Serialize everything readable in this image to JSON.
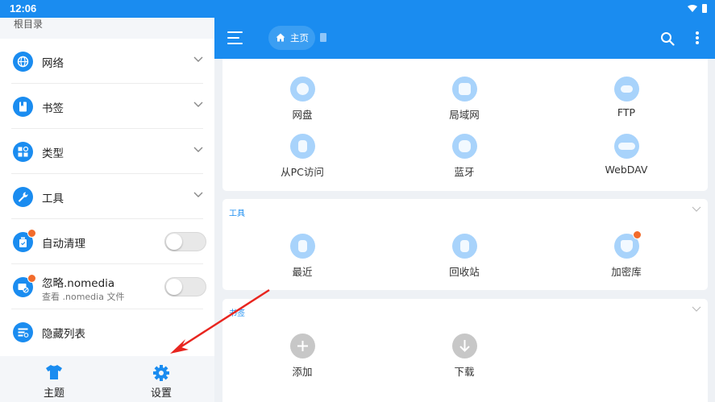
{
  "status_bar": {
    "time": "12:06"
  },
  "drawer": {
    "header_label": "根目录",
    "items": [
      {
        "label": "网络",
        "icon": "globe-icon",
        "trailing": "chevron"
      },
      {
        "label": "书签",
        "icon": "bookmark-icon",
        "trailing": "chevron"
      },
      {
        "label": "类型",
        "icon": "category-icon",
        "trailing": "chevron"
      },
      {
        "label": "工具",
        "icon": "wrench-icon",
        "trailing": "chevron"
      },
      {
        "label": "自动清理",
        "icon": "auto-clean-icon",
        "trailing": "toggle",
        "toggle_on": false,
        "premium": true
      },
      {
        "label": "忽略.nomedia",
        "sublabel": "查看 .nomedia 文件",
        "icon": "nomedia-icon",
        "trailing": "toggle",
        "toggle_on": false,
        "premium": true
      },
      {
        "label": "隐藏列表",
        "icon": "hidden-list-icon",
        "trailing": "none"
      }
    ],
    "footer": {
      "theme_label": "主题",
      "settings_label": "设置"
    }
  },
  "appbar": {
    "breadcrumb_label": "主页",
    "icons": [
      "menu-icon",
      "home-icon",
      "search-icon",
      "more-vert-icon"
    ]
  },
  "sections": {
    "network": {
      "tiles": [
        {
          "label": "网盘",
          "icon": "cloud-icon"
        },
        {
          "label": "局域网",
          "icon": "lan-icon"
        },
        {
          "label": "FTP",
          "icon": "ftp-icon"
        },
        {
          "label": "从PC访问",
          "icon": "pc-access-icon"
        },
        {
          "label": "蓝牙",
          "icon": "bluetooth-icon"
        },
        {
          "label": "WebDAV",
          "icon": "webdav-icon"
        }
      ]
    },
    "tools": {
      "title": "工具",
      "tiles": [
        {
          "label": "最近",
          "icon": "recent-icon"
        },
        {
          "label": "回收站",
          "icon": "recycle-bin-icon"
        },
        {
          "label": "加密库",
          "icon": "vault-icon",
          "premium": true
        }
      ]
    },
    "bookmarks": {
      "title": "书签",
      "tiles": [
        {
          "label": "添加",
          "icon": "add-icon"
        },
        {
          "label": "下载",
          "icon": "download-icon"
        }
      ]
    }
  },
  "colors": {
    "primary": "#1a8cf0",
    "tile_bg": "#a8d3fb",
    "premium_badge": "#f26b2b",
    "annotation_arrow": "#e8251f"
  }
}
